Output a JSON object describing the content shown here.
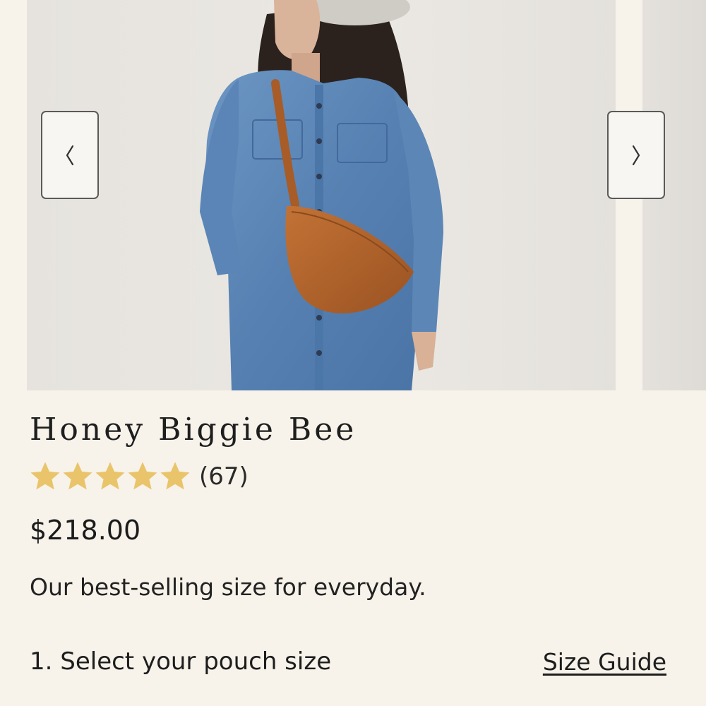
{
  "gallery": {
    "photo_alt": "Model wearing a denim shirt dress with a cognac leather crossbody half-moon bag",
    "prev_icon": "chevron-left-icon",
    "next_icon": "chevron-right-icon"
  },
  "product": {
    "title": "Honey Biggie Bee",
    "rating": {
      "stars": 5,
      "filled": 5,
      "count_text": "(67)"
    },
    "price": "$218.00",
    "description": "Our best-selling size for everyday."
  },
  "size_selection": {
    "step_label": "1. Select your pouch size",
    "size_guide_label": "Size Guide"
  },
  "colors": {
    "background": "#f7f3ea",
    "star": "#e9c46a",
    "bag": "#b5652b",
    "denim": "#5b86b5"
  }
}
